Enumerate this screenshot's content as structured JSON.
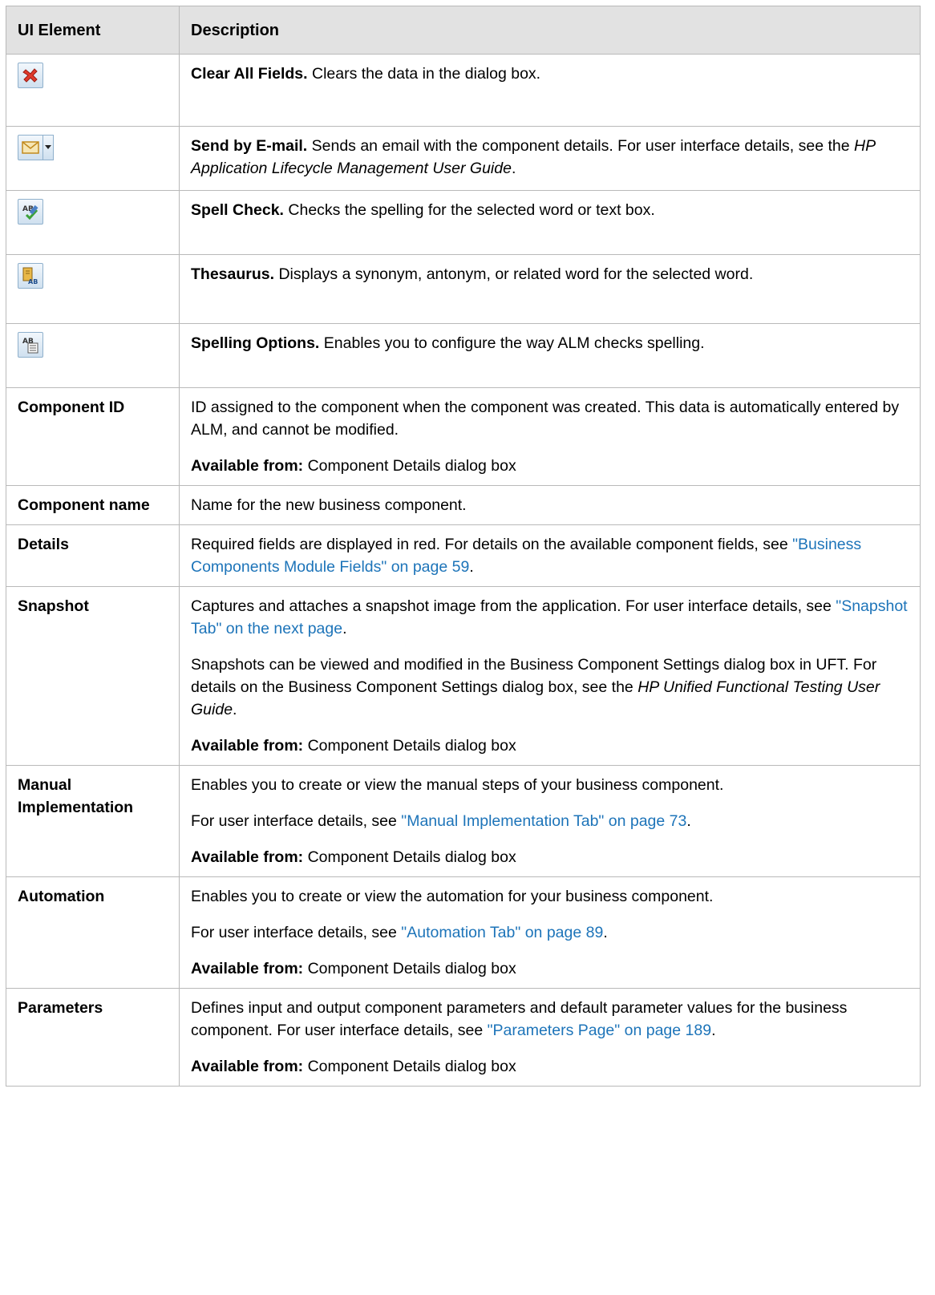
{
  "header": {
    "col1": "UI Element",
    "col2": "Description"
  },
  "rows": [
    {
      "icon": "clear-all-fields-icon",
      "title": "Clear All Fields.",
      "text": "Clears the data in the dialog box."
    },
    {
      "icon": "send-by-email-icon",
      "title": "Send by E-mail.",
      "text": "Sends an email with the component details. For user interface details, see the ",
      "guide": "HP Application Lifecycle Management User Guide",
      "end": "."
    },
    {
      "icon": "spell-check-icon",
      "title": "Spell Check.",
      "text": "Checks the spelling for the selected word or text box."
    },
    {
      "icon": "thesaurus-icon",
      "title": "Thesaurus.",
      "text": "Displays a synonym, antonym, or related word for the selected word."
    },
    {
      "icon": "spelling-options-icon",
      "title": "Spelling Options.",
      "text": "Enables you to configure the way ALM checks spelling."
    },
    {
      "label": "Component ID",
      "p1": "ID assigned to the component when the component was created. This data is automatically entered by ALM, and cannot be modified.",
      "avail_label": "Available from:",
      "avail_value": "Component Details dialog box"
    },
    {
      "label": "Component name",
      "p1": "Name for the new business component."
    },
    {
      "label": "Details",
      "p1": "Required fields are displayed in red. For details on the available component fields, see ",
      "link": "\"Business Components Module Fields\" on page 59",
      "end": "."
    },
    {
      "label": "Snapshot",
      "p1": "Captures and attaches a snapshot image from the application. For user interface details, see ",
      "link": "\"Snapshot Tab\" on the next page",
      "end": ".",
      "p2": "Snapshots can be viewed and modified in the Business Component Settings dialog box in UFT. For details on the Business Component Settings dialog box, see the ",
      "guide": "HP Unified Functional Testing User Guide",
      "end2": ".",
      "avail_label": "Available from:",
      "avail_value": "Component Details dialog box"
    },
    {
      "label": "Manual Implementation",
      "p1": "Enables you to create or view the manual steps of your business component.",
      "p2": "For user interface details, see ",
      "link": "\"Manual Implementation Tab\" on page 73",
      "end": ".",
      "avail_label": "Available from:",
      "avail_value": "Component Details dialog box"
    },
    {
      "label": "Automation",
      "p1": "Enables you to create or view the automation for your business component.",
      "p2": "For user interface details, see ",
      "link": "\"Automation Tab\" on page 89",
      "end": ".",
      "avail_label": "Available from:",
      "avail_value": "Component Details dialog box"
    },
    {
      "label": "Parameters",
      "p1": "Defines input and output component parameters and default parameter values for the business component. For user interface details, see ",
      "link": "\"Parameters Page\" on page 189",
      "end": ".",
      "avail_label": "Available from:",
      "avail_value": "Component Details dialog box"
    }
  ]
}
